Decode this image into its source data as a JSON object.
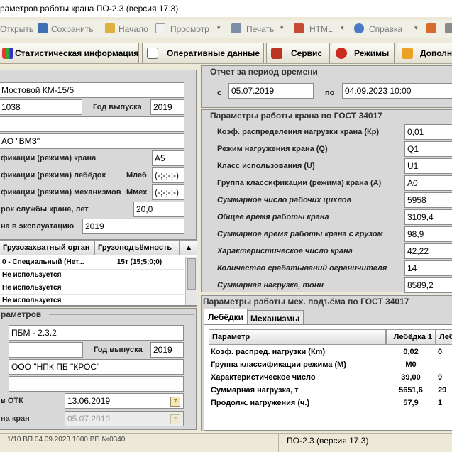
{
  "window": {
    "title": "раметров работы крана ПО-2.3 (версия 17.3)"
  },
  "toolbar": {
    "items": [
      "Открыть",
      "Сохранить",
      "Начало",
      "Просмотр",
      "Печать",
      "HTML",
      "Справка"
    ],
    "dropdown_arrow": "▾"
  },
  "tabs": [
    "Статистическая информация",
    "Оперативные данные",
    "Сервис",
    "Режимы",
    "Дополн"
  ],
  "crane": {
    "model": "Мостовой КМ-15/5",
    "serial": "1038",
    "year_label": "Год выпуска",
    "year": "2019",
    "blank1": "",
    "manufacturer": "АО \"ВМЗ\"",
    "class_crane_label": "фикации (режима) крана",
    "class_crane": "А5",
    "class_winch_label": "фикации (режима) лебёдок",
    "class_winch_sub": "Млеб",
    "class_winch": "(-;-;-;-)",
    "class_mech_label": "фикации (режима) механизмов",
    "class_mech_sub": "Ммех",
    "class_mech": "(-;-;-;-)",
    "service_life_label": "рок службы крана, лет",
    "service_life": "20,0",
    "commission_label": "на в эксплуатацию",
    "commission": "2019"
  },
  "grip_table": {
    "headers": [
      "Грузозахватный орган",
      "Грузоподъёмность"
    ],
    "rows": [
      [
        "0 - Специальный (Нет...",
        "15т (15;5;0;0)"
      ],
      [
        "Не используется",
        ""
      ],
      [
        "Не используется",
        ""
      ],
      [
        "Не используется",
        ""
      ]
    ]
  },
  "recorder": {
    "group_title": "раметров",
    "model": "ПБМ - 2.3.2",
    "serial": "",
    "year_label": "Год выпуска",
    "year": "2019",
    "manufacturer": "ООО \"НПК ПБ \"КРОС\"",
    "blank": "",
    "otk_label": "в ОТК",
    "otk_date": "13.06.2019",
    "install_label": "на кран",
    "install_date": "05.07.2019",
    "cal_glyph": "7"
  },
  "period": {
    "group_title": "Отчет за период времени",
    "from_label": "с",
    "from": "05.07.2019",
    "to_label": "по",
    "to": "04.09.2023  10:00"
  },
  "gost": {
    "group_title": "Параметры работы крана по ГОСТ 34017",
    "rows": [
      {
        "label": "Коэф. распределения нагрузки крана (Кр)",
        "value": "0,01",
        "italic": false
      },
      {
        "label": "Режим нагружения крана (Q)",
        "value": "Q1",
        "italic": false
      },
      {
        "label": "Класс использования (U)",
        "value": "U1",
        "italic": false
      },
      {
        "label": "Группа классификации (режима) крана (А)",
        "value": "А0",
        "italic": false
      },
      {
        "label": "Суммарное число рабочих циклов",
        "value": "5958",
        "italic": true
      },
      {
        "label": "Общее время работы крана",
        "value": "3109,4",
        "italic": true
      },
      {
        "label": "Суммарное время работы крана с грузом",
        "value": "98,9",
        "italic": true
      },
      {
        "label": "Характеристическое число крана",
        "value": "42,22",
        "italic": true
      },
      {
        "label": "Количество срабатываний ограничителя",
        "value": "14",
        "italic": true
      },
      {
        "label": "Суммарная нагрузка, тонн",
        "value": "8589,2",
        "italic": true
      }
    ]
  },
  "mech": {
    "group_title": "Параметры работы мех. подъёма по ГОСТ 34017",
    "subtabs": [
      "Лебёдки",
      "Механизмы"
    ],
    "headers": [
      "Параметр",
      "Лебёдка 1",
      "Лебё"
    ],
    "rows": [
      [
        "Коэф. распред. нагрузки (Кm)",
        "0,02",
        "0"
      ],
      [
        "Группа классификации режима (М)",
        "М0",
        ""
      ],
      [
        "Характеристическое число",
        "39,00",
        "9"
      ],
      [
        "Суммарная нагрузка, т",
        "5651,6",
        "29"
      ],
      [
        "Продолж. нагружения (ч.)",
        "57,9",
        "1"
      ]
    ]
  },
  "status": {
    "left": "1/10             ВП   04.09.2023  1000  ВП №0340",
    "right": "ПО-2.3 (версия 17.3)"
  },
  "colors": {
    "window": "#ece9d8",
    "panel": "#d8d8d8",
    "accent_red": "#cc2a1e"
  }
}
